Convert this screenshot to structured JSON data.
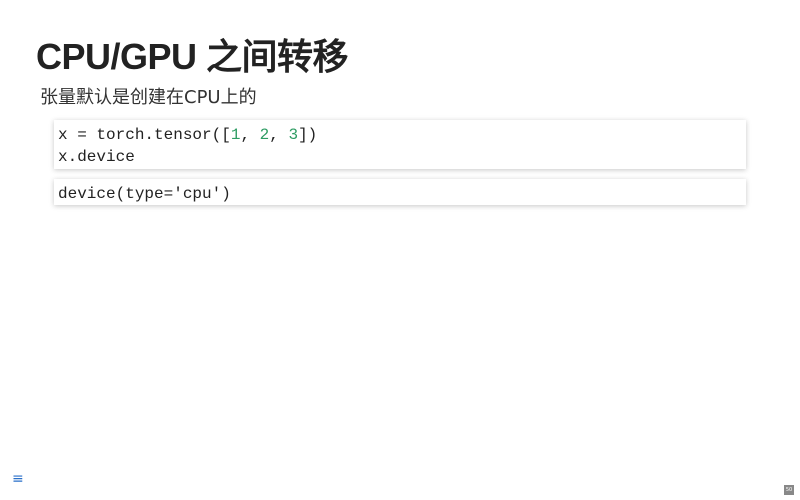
{
  "slide": {
    "title": "CPU/GPU 之间转移",
    "subtitle": "张量默认是创建在CPU上的",
    "code_input": {
      "line1": {
        "prefix": "x = torch.tensor([",
        "n1": "1",
        "sep1": ", ",
        "n2": "2",
        "sep2": ", ",
        "n3": "3",
        "suffix": "])"
      },
      "line2": "x.device"
    },
    "code_output": "device(type='cpu')",
    "slide_number": "50"
  },
  "controls": {
    "menu_icon": "hamburger-menu-icon",
    "menu_glyph": "≡"
  },
  "colors": {
    "number_literal": "#2e9c63",
    "menu_icon": "#2a6fc9"
  }
}
